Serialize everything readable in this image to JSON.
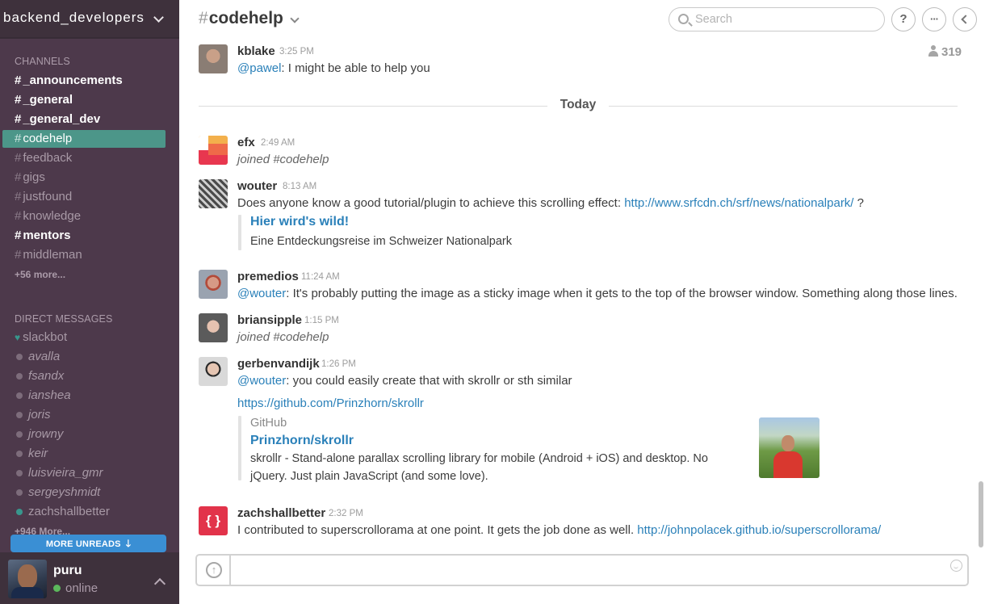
{
  "team": {
    "name": "backend_developers"
  },
  "sidebar": {
    "channels_label": "CHANNELS",
    "channels": [
      {
        "name": "_announcements",
        "state": "unread"
      },
      {
        "name": "_general",
        "state": "unread"
      },
      {
        "name": "_general_dev",
        "state": "unread"
      },
      {
        "name": "codehelp",
        "state": "active"
      },
      {
        "name": "feedback",
        "state": "read"
      },
      {
        "name": "gigs",
        "state": "read"
      },
      {
        "name": "justfound",
        "state": "read"
      },
      {
        "name": "knowledge",
        "state": "read"
      },
      {
        "name": "mentors",
        "state": "unread"
      },
      {
        "name": "middleman",
        "state": "read"
      }
    ],
    "channels_more": "+56 more...",
    "dm_label": "DIRECT MESSAGES",
    "direct_messages": [
      {
        "name": "slackbot",
        "status": "heart"
      },
      {
        "name": "avalla",
        "status": "away"
      },
      {
        "name": "fsandx",
        "status": "away"
      },
      {
        "name": "ianshea",
        "status": "away"
      },
      {
        "name": "joris",
        "status": "away"
      },
      {
        "name": "jrowny",
        "status": "away"
      },
      {
        "name": "keir",
        "status": "away"
      },
      {
        "name": "luisvieira_gmr",
        "status": "away"
      },
      {
        "name": "sergeyshmidt",
        "status": "away"
      },
      {
        "name": "zachshallbetter",
        "status": "online"
      }
    ],
    "dm_more": "+946 More...",
    "more_unreads": "MORE UNREADS"
  },
  "current_user": {
    "name": "puru",
    "status": "online"
  },
  "header": {
    "hash": "#",
    "channel": "codehelp",
    "search_placeholder": "Search",
    "help_label": "?",
    "more_label": "···",
    "member_count": "319"
  },
  "day_divider": "Today",
  "messages": [
    {
      "user": "kblake",
      "time": "3:25 PM",
      "mention": "@pawel",
      "text": ": I might be able to help you"
    },
    {
      "user": "efx",
      "time": "2:49 AM",
      "text": "joined #codehelp"
    },
    {
      "user": "wouter",
      "time": "8:13 AM",
      "text": "Does anyone know a good tutorial/plugin to achieve this scrolling effect: ",
      "link": "http://www.srfcdn.ch/srf/news/nationalpark/",
      "text_after": " ?",
      "attachment": {
        "title": "Hier wird's wild!",
        "text": "Eine Entdeckungsreise im Schweizer Nationalpark"
      }
    },
    {
      "user": "premedios",
      "time": "11:24 AM",
      "mention": "@wouter",
      "text": ": It's probably putting the image as a sticky image when it gets to the top of the browser window. Something along those lines."
    },
    {
      "user": "briansipple",
      "time": "1:15 PM",
      "text": "joined #codehelp"
    },
    {
      "user": "gerbenvandijk",
      "time": "1:26 PM",
      "mention": "@wouter",
      "text": ": you could easily create that with skrollr or sth similar",
      "link": "https://github.com/Prinzhorn/skrollr",
      "attachment": {
        "service": "GitHub",
        "title": "Prinzhorn/skrollr",
        "text_line1": "skrollr - Stand-alone parallax scrolling library for mobile (Android + iOS) and desktop. No",
        "text_line2": "jQuery. Just plain JavaScript (and some love)."
      }
    },
    {
      "user": "zachshallbetter",
      "time": "2:32 PM",
      "text": "I contributed to superscrollorama at one point. It gets the job done as well. ",
      "link": "http://johnpolacek.github.io/superscrollorama/"
    }
  ],
  "composer": {
    "upload_label": "+",
    "value": ""
  },
  "colors": {
    "sidebar_bg": "#4d394b",
    "active_channel": "#4c9689",
    "link": "#2a80b9",
    "more_unreads": "#3a8fd4"
  }
}
